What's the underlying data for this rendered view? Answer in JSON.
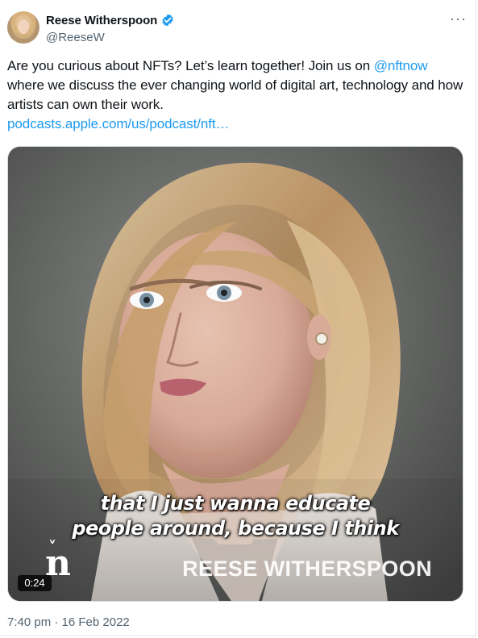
{
  "author": {
    "display_name": "Reese Witherspoon",
    "handle": "@ReeseW",
    "verified_icon": "verified-badge-icon",
    "avatar": "author-avatar"
  },
  "actions": {
    "more_icon": "more-options-icon",
    "more_label": "···"
  },
  "tweet": {
    "text_before": "Are you curious about NFTs? Let’s learn together! Join us on ",
    "mention": "@nftnow",
    "text_after": " where we discuss the ever changing world of digital art, technology and how artists can own their work.",
    "link": "podcasts.apple.com/us/podcast/nft…"
  },
  "media": {
    "caption_line_1": "that I just wanna educate",
    "caption_line_2": "people around, because I think",
    "lower_third": "REESE WITHERSPOON",
    "watermark_letter": "n",
    "watermark_accent": "˅",
    "duration": "0:24"
  },
  "meta": {
    "timestamp": "7:40 pm · 16 Feb 2022"
  },
  "colors": {
    "link": "#1d9bf0",
    "secondary_text": "#536471",
    "verified": "#1d9bf0"
  }
}
